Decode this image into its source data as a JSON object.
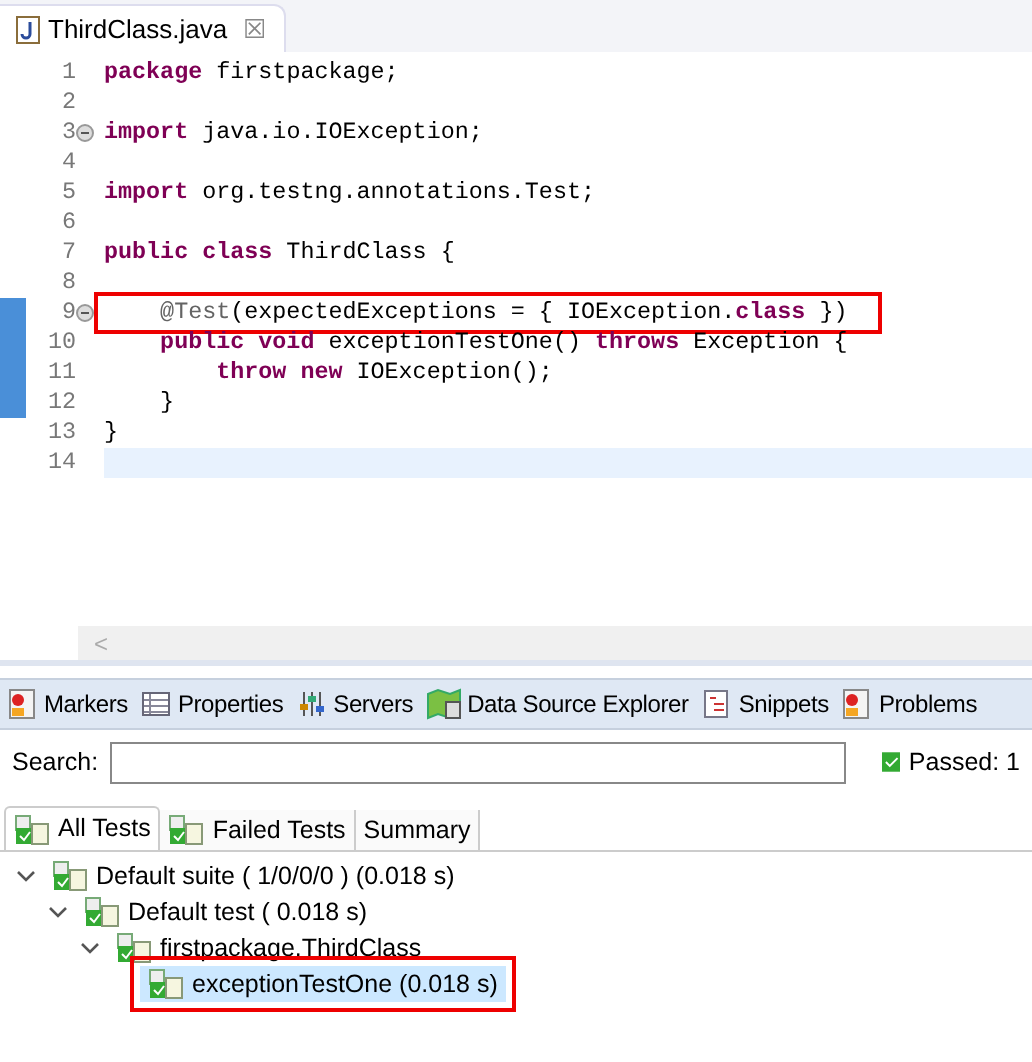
{
  "editor_tab": {
    "title": "ThirdClass.java",
    "close": "☒"
  },
  "code_lines": [
    {
      "number": "1",
      "foldable": false,
      "modified": false,
      "current": false,
      "highlighted": false,
      "tokens": [
        {
          "kind": "keyword",
          "text": "package"
        },
        {
          "kind": "plain",
          "text": " firstpackage;"
        }
      ]
    },
    {
      "number": "2",
      "foldable": false,
      "modified": false,
      "current": false,
      "highlighted": false
    },
    {
      "number": "3",
      "foldable": true,
      "modified": false,
      "current": false,
      "highlighted": false,
      "tokens": [
        {
          "kind": "keyword",
          "text": "import"
        },
        {
          "kind": "plain",
          "text": " java.io.IOException;"
        }
      ]
    },
    {
      "number": "4",
      "foldable": false,
      "modified": false,
      "current": false,
      "highlighted": false
    },
    {
      "number": "5",
      "foldable": false,
      "modified": false,
      "current": false,
      "highlighted": false,
      "tokens": [
        {
          "kind": "keyword",
          "text": "import"
        },
        {
          "kind": "plain",
          "text": " org.testng.annotations.Test;"
        }
      ]
    },
    {
      "number": "6",
      "foldable": false,
      "modified": false,
      "current": false,
      "highlighted": false
    },
    {
      "number": "7",
      "foldable": false,
      "modified": false,
      "current": false,
      "highlighted": false,
      "tokens": [
        {
          "kind": "keyword",
          "text": "public class"
        },
        {
          "kind": "plain",
          "text": " ThirdClass {"
        }
      ]
    },
    {
      "number": "8",
      "foldable": false,
      "modified": false,
      "current": false,
      "highlighted": false
    },
    {
      "number": "9",
      "foldable": true,
      "modified": true,
      "current": false,
      "highlighted": true,
      "tokens": [
        {
          "kind": "annotation",
          "text": "    @Test"
        },
        {
          "kind": "plain",
          "text": "(expectedExceptions = { IOException."
        },
        {
          "kind": "keyword",
          "text": "class"
        },
        {
          "kind": "plain",
          "text": " })"
        }
      ]
    },
    {
      "number": "10",
      "foldable": false,
      "modified": true,
      "current": false,
      "highlighted": false,
      "tokens": [
        {
          "kind": "keyword",
          "text": "    public void"
        },
        {
          "kind": "plain",
          "text": " exceptionTestOne() "
        },
        {
          "kind": "keyword",
          "text": "throws"
        },
        {
          "kind": "plain",
          "text": " Exception {"
        }
      ]
    },
    {
      "number": "11",
      "foldable": false,
      "modified": true,
      "current": false,
      "highlighted": false,
      "tokens": [
        {
          "kind": "keyword",
          "text": "        throw new"
        },
        {
          "kind": "plain",
          "text": " IOException();"
        }
      ]
    },
    {
      "number": "12",
      "foldable": false,
      "modified": true,
      "current": false,
      "highlighted": false,
      "tokens": [
        {
          "kind": "plain",
          "text": "    }"
        }
      ]
    },
    {
      "number": "13",
      "foldable": false,
      "modified": false,
      "current": false,
      "highlighted": false,
      "tokens": [
        {
          "kind": "plain",
          "text": "}"
        }
      ]
    },
    {
      "number": "14",
      "foldable": false,
      "modified": false,
      "current": true,
      "highlighted": false
    }
  ],
  "scroll_left": "<",
  "views": [
    {
      "label": "Markers",
      "kind": "markers"
    },
    {
      "label": "Properties",
      "kind": "properties"
    },
    {
      "label": "Servers",
      "kind": "servers"
    },
    {
      "label": "Data Source Explorer",
      "kind": "datasource"
    },
    {
      "label": "Snippets",
      "kind": "snippets"
    },
    {
      "label": "Problems",
      "kind": "markers"
    }
  ],
  "search": {
    "label": "Search:"
  },
  "passed": "Passed: 1",
  "result_tabs": [
    {
      "label": "All Tests",
      "icon": true,
      "selected": true
    },
    {
      "label": "Failed Tests",
      "icon": true,
      "selected": false
    },
    {
      "label": "Summary",
      "icon": false,
      "selected": false
    }
  ],
  "tree": [
    {
      "label": "Default suite ( 1/0/0/0 ) (0.018 s)",
      "expanded": true,
      "selected": false,
      "highlighted": false,
      "children": [
        {
          "label": "Default test ( 0.018 s)",
          "expanded": true,
          "selected": false,
          "highlighted": false,
          "children": [
            {
              "label": "firstpackage.ThirdClass",
              "expanded": true,
              "selected": false,
              "highlighted": false,
              "children": [
                {
                  "label": "exceptionTestOne  (0.018 s)",
                  "selected": true,
                  "highlighted": true
                }
              ]
            }
          ]
        }
      ]
    }
  ]
}
